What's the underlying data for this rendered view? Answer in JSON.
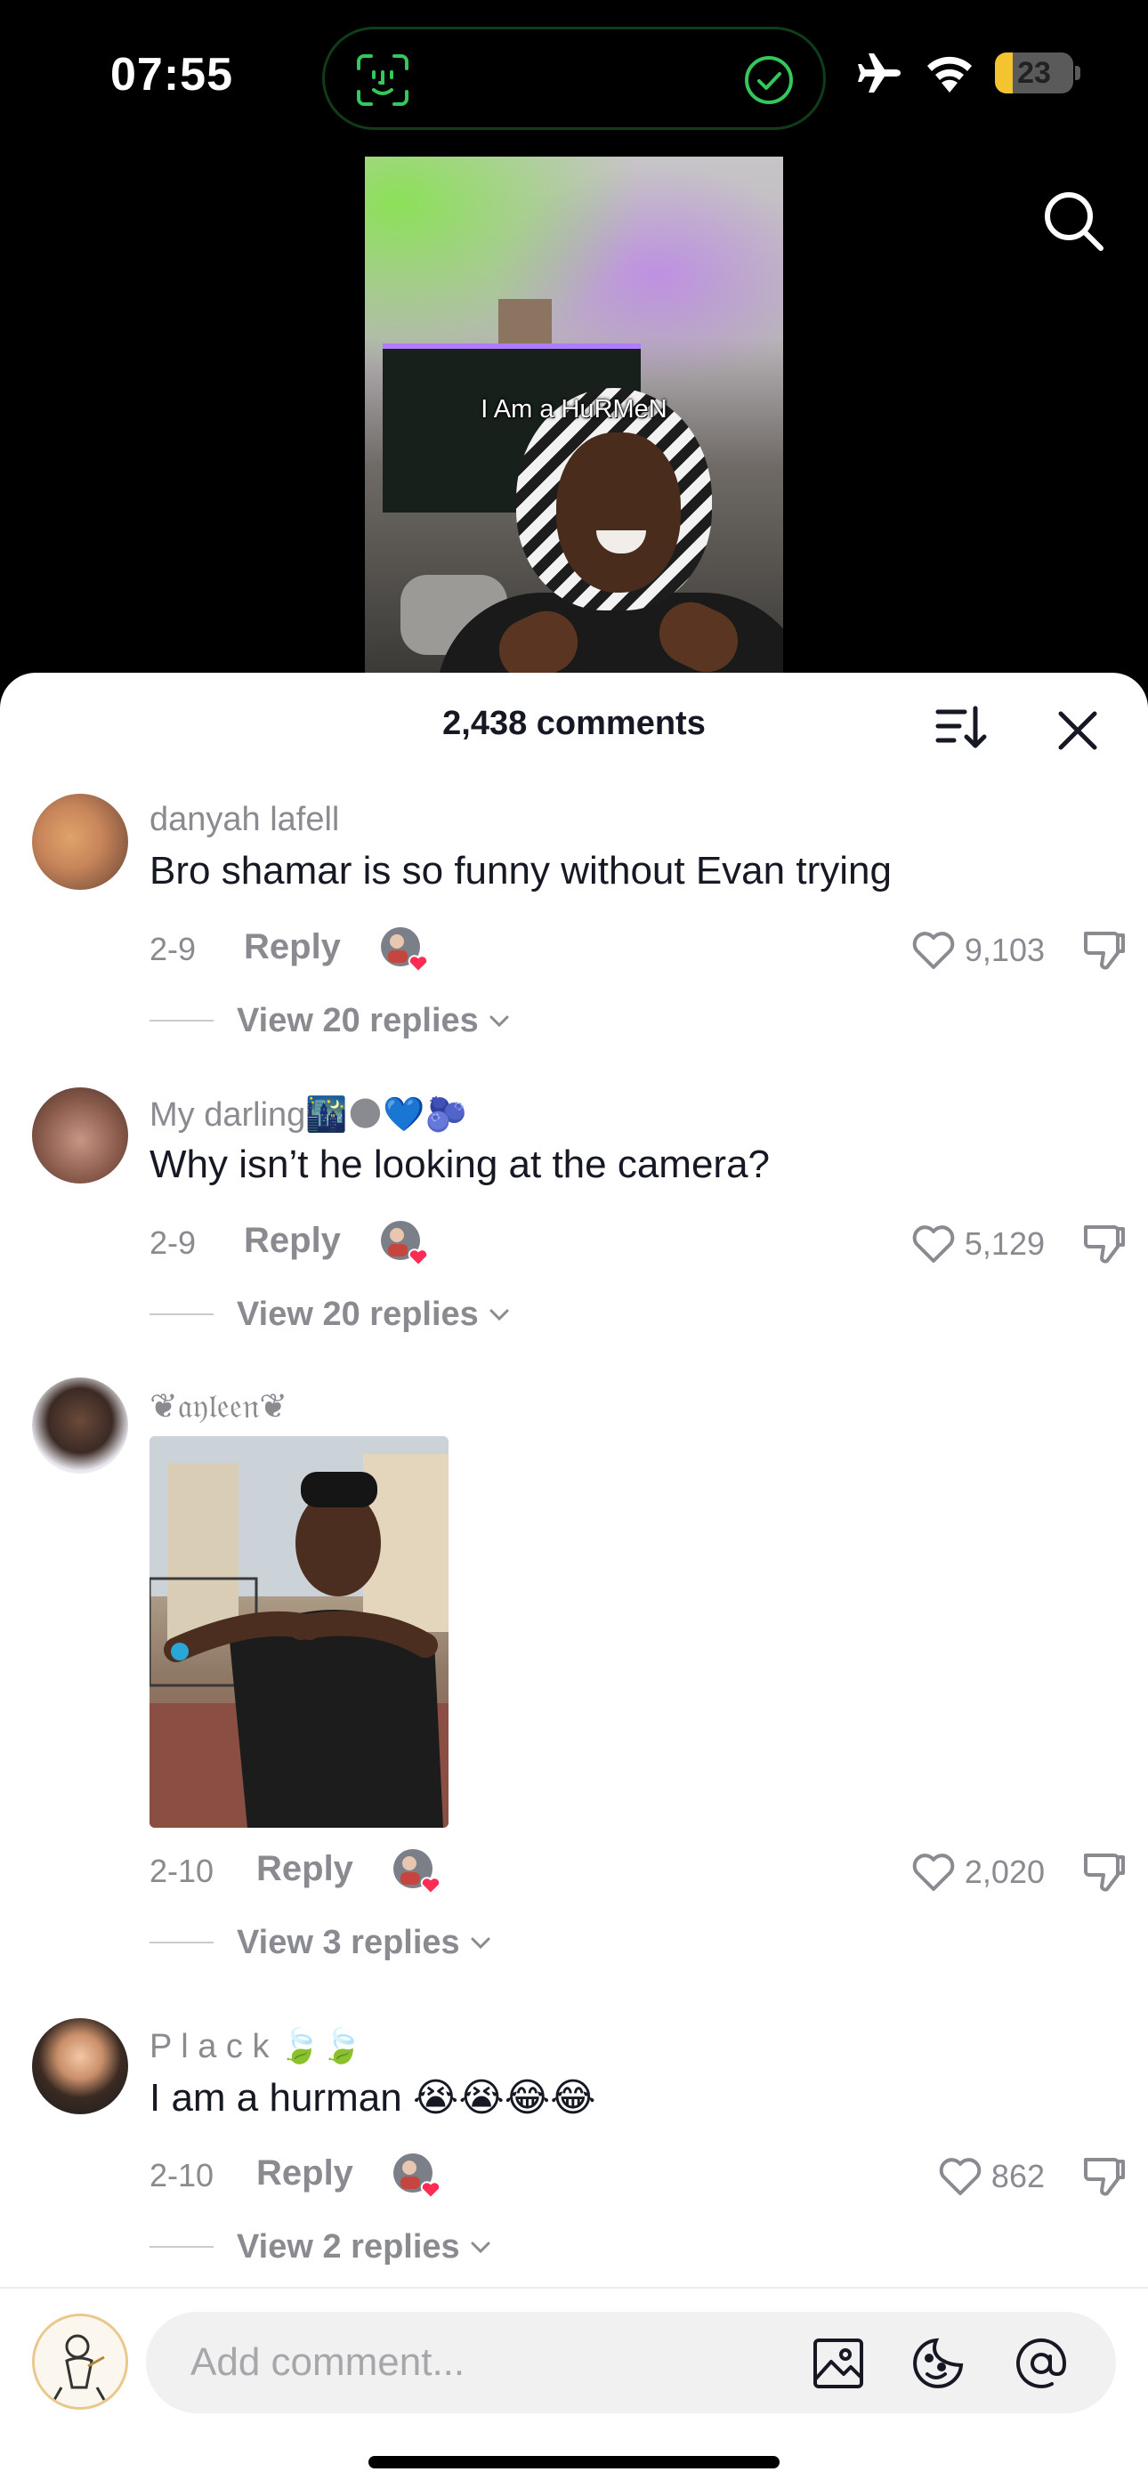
{
  "status_bar": {
    "time": "07:55",
    "battery_level": "23",
    "battery_fraction": 0.23,
    "icons": [
      "face-id-icon",
      "check-circle-icon",
      "airplane-icon",
      "wifi-icon",
      "battery-icon"
    ]
  },
  "video": {
    "caption": "I Am a HuRMeN"
  },
  "sheet": {
    "title": "2,438 comments"
  },
  "comments": [
    {
      "username": "danyah lafell",
      "text": "Bro shamar is so funny without Evan trying",
      "date": "2-9",
      "reply_label": "Reply",
      "likes": "9,103",
      "view_replies": "View 20 replies"
    },
    {
      "username": "My darling🌃🌑💙🫐",
      "text": "Why isn’t he looking at the camera?",
      "date": "2-9",
      "reply_label": "Reply",
      "likes": "5,129",
      "view_replies": "View 20 replies"
    },
    {
      "username": "❦𝔞𝔶𝔩𝔢𝔢𝔫❦",
      "text": "",
      "has_image": true,
      "date": "2-10",
      "reply_label": "Reply",
      "likes": "2,020",
      "view_replies": "View 3 replies"
    },
    {
      "username": "P l a c k 🍃🍃",
      "text": "I am a hurman 😭😭😂😂",
      "date": "2-10",
      "reply_label": "Reply",
      "likes": "862",
      "view_replies": "View 2 replies"
    }
  ],
  "composer": {
    "placeholder": "Add comment..."
  },
  "colors": {
    "liked_heart": "#fe2c55",
    "secondary_text": "#8a8b91",
    "primary_text": "#161823",
    "battery_fill": "#f4c430",
    "face_id_green": "#34c759"
  }
}
